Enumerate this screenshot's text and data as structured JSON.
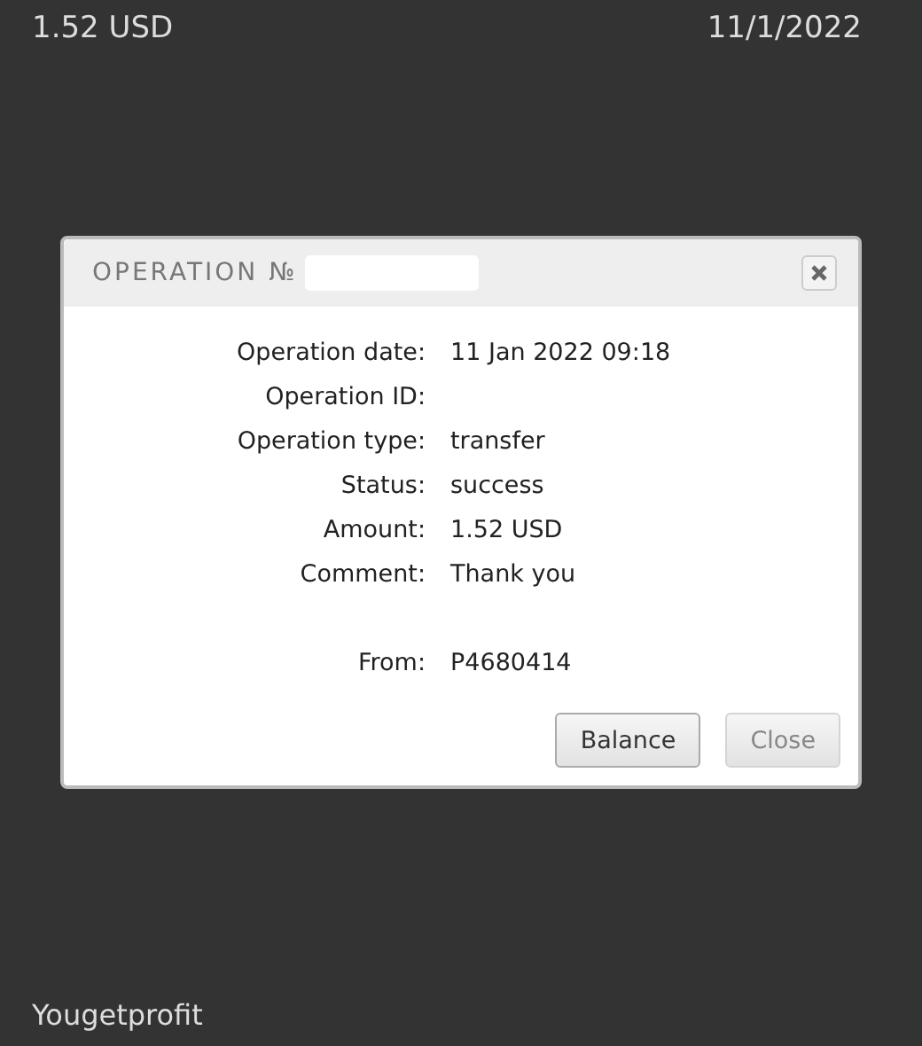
{
  "header": {
    "amount": "1.52 USD",
    "date": "11/1/2022"
  },
  "dialog": {
    "title": "OPERATION №",
    "redacted": true,
    "fields": [
      {
        "label": "Operation date:",
        "value": "11 Jan 2022 09:18"
      },
      {
        "label": "Operation ID:"
      },
      {
        "label": "Operation type:",
        "value": "transfer"
      },
      {
        "label": "Status:",
        "value": "success"
      },
      {
        "label": "Amount:",
        "value": "1.52 USD"
      },
      {
        "label": "Comment:",
        "value": "Thank you"
      },
      {
        "kind": "gap"
      },
      {
        "label": "From:",
        "value": "P4680414"
      }
    ],
    "buttons": [
      {
        "label": "Balance",
        "disabled": false
      },
      {
        "label": "Close",
        "disabled": true
      }
    ]
  },
  "footer": {
    "project": "Yougetprofit"
  }
}
